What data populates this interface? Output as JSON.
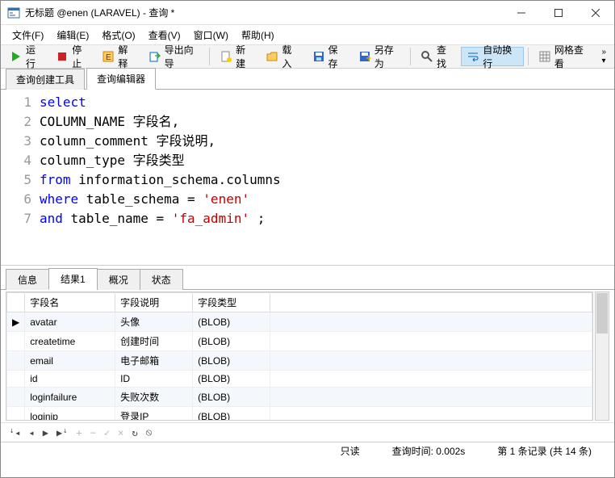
{
  "window": {
    "title": "无标题 @enen (LARAVEL) - 查询 *"
  },
  "menu": {
    "file": "文件(F)",
    "edit": "编辑(E)",
    "format": "格式(O)",
    "view": "查看(V)",
    "window": "窗口(W)",
    "help": "帮助(H)"
  },
  "toolbar": {
    "run": "运行",
    "stop": "停止",
    "explain": "解释",
    "export": "导出向导",
    "new": "新建",
    "load": "载入",
    "save": "保存",
    "saveas": "另存为",
    "find": "查找",
    "wrap": "自动换行",
    "gridview": "网格查看"
  },
  "editor_tabs": {
    "builder": "查询创建工具",
    "editor": "查询编辑器"
  },
  "code": {
    "lines": [
      "1",
      "2",
      "3",
      "4",
      "5",
      "6",
      "7"
    ],
    "l1_kw": "select",
    "l2": "COLUMN_NAME 字段名,",
    "l3": "column_comment 字段说明,",
    "l4": "column_type 字段类型",
    "l5_kw": "from",
    "l5_rest": " information_schema.columns",
    "l6_kw": "where",
    "l6_mid": " table_schema = ",
    "l6_str": "'enen'",
    "l7_kw": "and",
    "l7_mid": " table_name = ",
    "l7_str": "'fa_admin'",
    "l7_end": " ;"
  },
  "result_tabs": {
    "info": "信息",
    "r1": "结果1",
    "profile": "概况",
    "status": "状态"
  },
  "grid": {
    "headers": [
      "字段名",
      "字段说明",
      "字段类型"
    ],
    "rows": [
      [
        "avatar",
        "头像",
        "(BLOB)"
      ],
      [
        "createtime",
        "创建时间",
        "(BLOB)"
      ],
      [
        "email",
        "电子邮箱",
        "(BLOB)"
      ],
      [
        "id",
        "ID",
        "(BLOB)"
      ],
      [
        "loginfailure",
        "失败次数",
        "(BLOB)"
      ],
      [
        "loginip",
        "登录IP",
        "(BLOB)"
      ]
    ]
  },
  "status": {
    "readonly": "只读",
    "time": "查询时间: 0.002s",
    "records": "第 1 条记录 (共 14 条)"
  },
  "nav_icons": "ꜜ◂ ◂  ▶ ▶ꜜ   +  −  ✓  ×   ↻  ⦸"
}
